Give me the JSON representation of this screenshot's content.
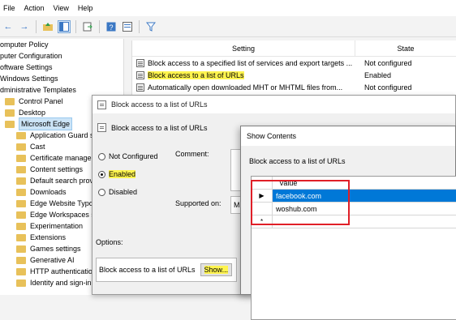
{
  "menu": [
    "File",
    "Action",
    "View",
    "Help"
  ],
  "toolbar_icons": [
    "back-arrow-icon",
    "forward-arrow-icon",
    "folder-up-icon",
    "show-hide-tree-icon",
    "export-list-icon",
    "help-icon",
    "properties-icon",
    "filter-icon"
  ],
  "tree": {
    "items": [
      {
        "label": "omputer Policy",
        "level": 0
      },
      {
        "label": "puter Configuration",
        "level": 0
      },
      {
        "label": "oftware Settings",
        "level": 0
      },
      {
        "label": "Windows Settings",
        "level": 0
      },
      {
        "label": "dministrative Templates",
        "level": 0
      },
      {
        "label": "Control Panel",
        "level": 1
      },
      {
        "label": "Desktop",
        "level": 1
      },
      {
        "label": "Microsoft Edge",
        "level": 1,
        "selected": true
      },
      {
        "label": "Application Guard sett",
        "level": 2
      },
      {
        "label": "Cast",
        "level": 2
      },
      {
        "label": "Certificate managem",
        "level": 2
      },
      {
        "label": "Content settings",
        "level": 2
      },
      {
        "label": "Default search provide",
        "level": 2
      },
      {
        "label": "Downloads",
        "level": 2
      },
      {
        "label": "Edge Website Typo Pro",
        "level": 2
      },
      {
        "label": "Edge Workspaces setti",
        "level": 2
      },
      {
        "label": "Experimentation",
        "level": 2
      },
      {
        "label": "Extensions",
        "level": 2
      },
      {
        "label": "Games settings",
        "level": 2
      },
      {
        "label": "Generative AI",
        "level": 2
      },
      {
        "label": "HTTP authentication",
        "level": 2
      },
      {
        "label": "Identity and sign-in",
        "level": 2
      }
    ]
  },
  "list": {
    "col_setting": "Setting",
    "col_state": "State",
    "rows": [
      {
        "setting": "Block access to a specified list of services and export targets ...",
        "state": "Not configured"
      },
      {
        "setting": "Block access to a list of URLs",
        "state": "Enabled",
        "highlight": true
      },
      {
        "setting": "Automatically open downloaded MHT or MHTML files from...",
        "state": "Not configured"
      }
    ]
  },
  "policy_dialog": {
    "window_title": "Block access to a list of URLs",
    "heading": "Block access to a list of URLs",
    "not_configured": "Not Configured",
    "enabled": "Enabled",
    "disabled": "Disabled",
    "selected_option": "Enabled",
    "comment_label": "Comment:",
    "supported_label": "Supported on:",
    "supported_value": "M",
    "options_label": "Options:",
    "option_text": "Block access to a list of URLs",
    "show_button": "Show..."
  },
  "show_contents": {
    "title": "Show Contents",
    "subtitle": "Block access to a list of URLs",
    "column_header": "Value",
    "rows": [
      "facebook.com",
      "woshub.com"
    ],
    "selected_row": 0,
    "new_row_marker": "*",
    "current_row_marker": "▶"
  },
  "colors": {
    "highlight": "#fff44f",
    "selection": "#0078d7",
    "annotation_red": "#e01f27"
  }
}
